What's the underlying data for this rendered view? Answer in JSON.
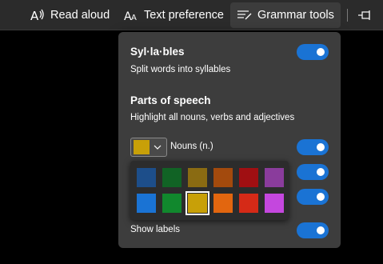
{
  "toolbar": {
    "read_aloud": "Read aloud",
    "text_preference": "Text preference",
    "grammar_tools": "Grammar tools",
    "icons": [
      "read-aloud-icon",
      "text-preference-icon",
      "grammar-tools-icon",
      "pin-icon"
    ]
  },
  "panel": {
    "syllables_title": "Syl·la·bles",
    "syllables_desc": "Split words into syllables",
    "syllables_on": true,
    "pos_title": "Parts of speech",
    "pos_desc": "Highlight all nouns, verbs and adjectives",
    "nouns_label": "Nouns (n.)",
    "nouns_color": "#c8a008",
    "nouns_on": true,
    "verbs_on": true,
    "adjectives_on": true,
    "show_labels": "Show labels",
    "show_labels_on": true
  },
  "palette": {
    "row1": [
      "#1d4e8a",
      "#116325",
      "#8a6b12",
      "#a34a0d",
      "#a00f12",
      "#8a3c9c"
    ],
    "row2": [
      "#1a73d4",
      "#11882d",
      "#c8a008",
      "#e2660f",
      "#d52a17",
      "#c447de"
    ],
    "selected": "#c8a008"
  },
  "colors": {
    "toolbar_bg": "#2b2b2b",
    "panel_bg": "#3d3d3d",
    "toggle_on": "#1a73d4",
    "background": "#000000"
  }
}
